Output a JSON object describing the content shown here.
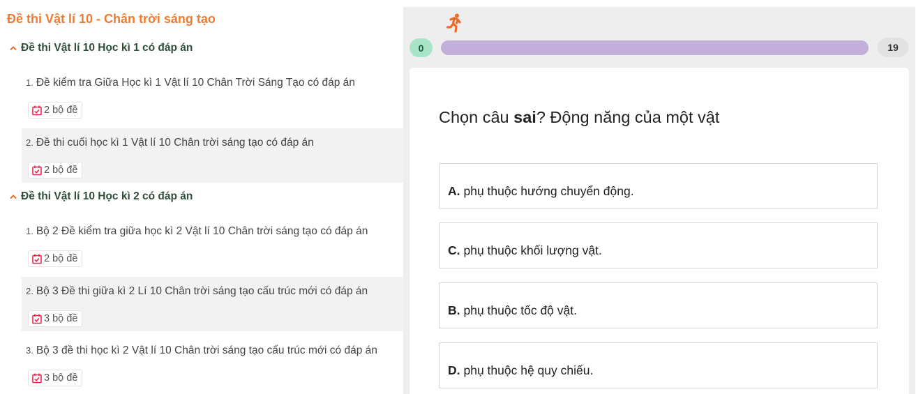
{
  "left": {
    "title": "Đề thi Vật lí 10 - Chân trời sáng tạo",
    "sections": [
      {
        "heading": "Đề thi Vật lí 10 Học kì 1 có đáp án",
        "items": [
          {
            "num": "1.",
            "title": "Đề kiểm tra Giữa Học kì 1 Vật lí 10 Chân Trời Sáng Tạo có đáp án",
            "badge": "2 bộ đề"
          },
          {
            "num": "2.",
            "title": "Đề thi cuối học kì 1 Vật lí 10 Chân trời sáng tạo có đáp án",
            "badge": "2 bộ đề"
          }
        ]
      },
      {
        "heading": "Đề thi Vật lí 10 Học kì 2 có đáp án",
        "items": [
          {
            "num": "1.",
            "title": "Bộ 2 Đề kiểm tra giữa học kì 2 Vật lí 10 Chân trời sáng tạo có đáp án",
            "badge": "2 bộ đề"
          },
          {
            "num": "2.",
            "title": "Bộ 3 Đề thi giữa kì 2 Lí 10 Chân trời sáng tạo cấu trúc mới có đáp án",
            "badge": "3 bộ đề"
          },
          {
            "num": "3.",
            "title": "Bộ 3 đề thi học kì 2 Vật lí 10 Chân trời sáng tạo cấu trúc mới có đáp án",
            "badge": "3 bộ đề"
          }
        ]
      }
    ],
    "icons": {
      "section_toggle": "chevron-up-icon",
      "badge": "calendar-check-icon"
    }
  },
  "quiz": {
    "runner_icon": "running-person-icon",
    "score_current": "0",
    "score_total": "19",
    "progress_fraction": 0,
    "question_prefix": "Chọn câu ",
    "question_bold": "sai",
    "question_suffix": "? Động năng của một vật",
    "options": [
      {
        "letter": "A.",
        "text": "phụ thuộc hướng chuyển động."
      },
      {
        "letter": "C.",
        "text": "phụ thuộc khối lượng vật."
      },
      {
        "letter": "B.",
        "text": "phụ thuộc tốc độ vật."
      },
      {
        "letter": "D.",
        "text": "phụ thuộc hệ quy chiếu."
      }
    ]
  },
  "colors": {
    "accent_orange": "#ee7b33",
    "section_green": "#2f4f3a",
    "badge_icon": "#e8274b",
    "progress_track": "#c3b0da",
    "score_badge": "#a8e4c8"
  }
}
